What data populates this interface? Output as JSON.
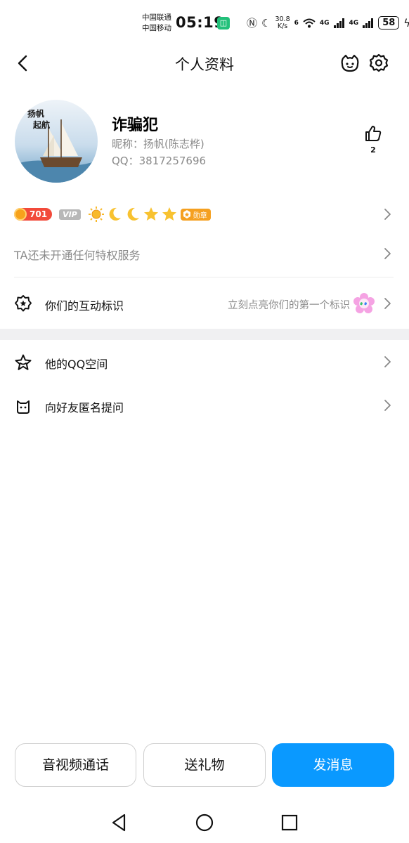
{
  "status_bar": {
    "carrier_1": "中国联通",
    "carrier_2": "中国移动",
    "time": "05:19",
    "net_speed_value": "30.8",
    "net_speed_unit": "K/s",
    "wifi_label": "6",
    "signal_1": "4G",
    "signal_2": "4G",
    "battery": "58"
  },
  "header": {
    "title": "个人资料",
    "back_icon": "chevron-left-icon",
    "pet_icon": "pet-icon",
    "settings_icon": "gear-icon"
  },
  "profile": {
    "avatar_text_1": "扬帆起航",
    "name": "诈骗犯",
    "nickname_line": "昵称：扬帆(陈志桦)",
    "qq_line": "QQ：3817257696",
    "like_count": "2"
  },
  "badges": {
    "level": "701",
    "vip": "VIP",
    "medal": "勋章"
  },
  "rows": {
    "privilege": "TA还未开通任何特权服务",
    "interaction_label": "你们的互动标识",
    "interaction_hint": "立刻点亮你们的第一个标识",
    "qzone": "他的QQ空间",
    "anon_ask": "向好友匿名提问"
  },
  "actions": {
    "call": "音视频通话",
    "gift": "送礼物",
    "message": "发消息"
  },
  "colors": {
    "primary": "#0a99ff",
    "level_badge": "#f24a3a",
    "medal": "#f5a020",
    "muted_text": "#8a8a8a"
  }
}
